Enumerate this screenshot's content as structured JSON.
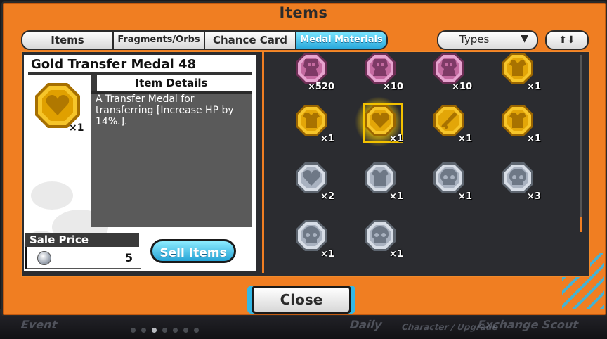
{
  "window": {
    "title": "Items",
    "close_label": "Close"
  },
  "tabs": [
    {
      "label": "Items",
      "active": false
    },
    {
      "label": "Fragments/Orbs",
      "active": false
    },
    {
      "label": "Chance Card",
      "active": false
    },
    {
      "label": "Medal Materials",
      "active": true
    }
  ],
  "filter": {
    "types_label": "Types",
    "types_arrow": "▼",
    "sort_label": "⬆⬇"
  },
  "selected_item": {
    "name": "Gold Transfer Medal 48",
    "quantity": "×1",
    "details_header": "Item Details",
    "description": "A Transfer Medal for transferring [Increase HP by 14%.].",
    "sale_price_label": "Sale Price",
    "sale_price": "5",
    "sell_button": "Sell Items"
  },
  "grid": [
    {
      "icon": "pink-character-medal-icon",
      "color": "pink",
      "qty": "×520"
    },
    {
      "icon": "pink-character-medal-icon",
      "color": "pink",
      "qty": "×10"
    },
    {
      "icon": "pink-character-medal-icon",
      "color": "pink",
      "qty": "×10"
    },
    {
      "icon": "gold-armor-medal-icon",
      "color": "gold",
      "qty": "×1"
    },
    {
      "icon": "gold-armor-medal-icon",
      "color": "gold",
      "qty": "×1"
    },
    {
      "icon": "gold-heart-medal-icon",
      "color": "gold",
      "qty": "×1",
      "selected": true
    },
    {
      "icon": "gold-sword-medal-icon",
      "color": "gold",
      "qty": "×1"
    },
    {
      "icon": "gold-armor-medal-icon",
      "color": "gold",
      "qty": "×1"
    },
    {
      "icon": "silver-heart-medal-icon",
      "color": "silver",
      "qty": "×2"
    },
    {
      "icon": "silver-armor-medal-icon",
      "color": "silver",
      "qty": "×1"
    },
    {
      "icon": "silver-skull-medal-icon",
      "color": "silver",
      "qty": "×1"
    },
    {
      "icon": "silver-skull-medal-icon",
      "color": "silver",
      "qty": "×3"
    },
    {
      "icon": "silver-skull-medal-icon",
      "color": "silver",
      "qty": "×1"
    },
    {
      "icon": "silver-skull-medal-icon",
      "color": "silver",
      "qty": "×1"
    }
  ],
  "background_nav": [
    "Event",
    "Daily",
    "Character / Upgrade",
    "Exchange",
    "Scout"
  ],
  "colors": {
    "frame": "#f07e22",
    "accent_blue": "#33b8e6",
    "gold": "#f2b51a",
    "silver": "#aeb6c4",
    "pink": "#c46aa0"
  }
}
